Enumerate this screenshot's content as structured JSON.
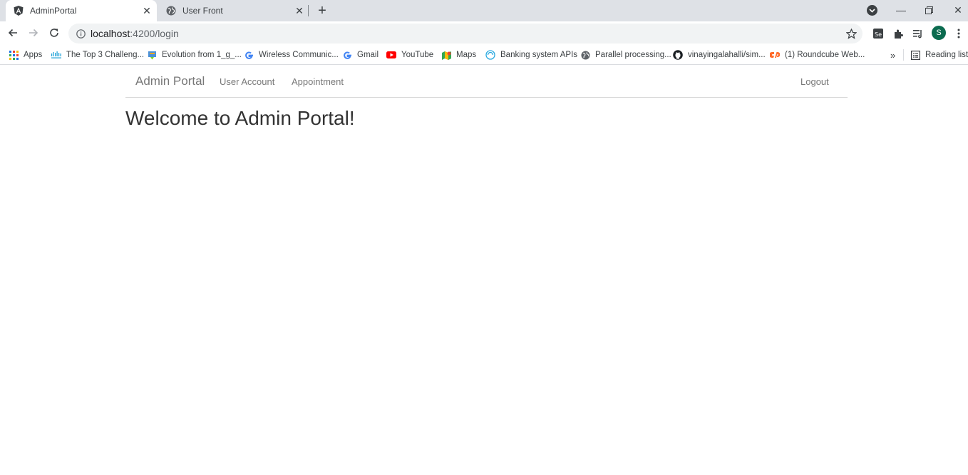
{
  "browser": {
    "tabs": [
      {
        "title": "AdminPortal",
        "favicon": "angular-icon",
        "active": true
      },
      {
        "title": "User Front",
        "favicon": "globe-icon",
        "active": false
      }
    ],
    "address": {
      "host": "localhost",
      "path": ":4200/login"
    },
    "profile_initial": "S",
    "bookmarks": [
      {
        "label": "Apps",
        "icon": "apps-grid-icon"
      },
      {
        "label": "The Top 3 Challeng...",
        "icon": "cisco-icon"
      },
      {
        "label": "Evolution from 1_g_...",
        "icon": "bookmark-site-icon"
      },
      {
        "label": "Wireless Communic...",
        "icon": "google-icon"
      },
      {
        "label": "Gmail",
        "icon": "google-icon"
      },
      {
        "label": "YouTube",
        "icon": "youtube-icon"
      },
      {
        "label": "Maps",
        "icon": "maps-icon"
      },
      {
        "label": "Banking system APIs",
        "icon": "swirl-icon"
      },
      {
        "label": "Parallel processing...",
        "icon": "globe-icon"
      },
      {
        "label": "vinayingalahalli/sim...",
        "icon": "github-icon"
      },
      {
        "label": "(1) Roundcube Web...",
        "icon": "cpanel-icon"
      }
    ],
    "overflow": "»",
    "reading_list": "Reading list"
  },
  "page": {
    "navbar": {
      "brand": "Admin Portal",
      "links": [
        "User Account",
        "Appointment"
      ],
      "logout": "Logout"
    },
    "heading": "Welcome to Admin Portal!"
  },
  "colors": {
    "tabstrip": "#dee1e6",
    "nav_text": "#777777",
    "heading_text": "#333333",
    "avatar": "#0b6b4f"
  }
}
